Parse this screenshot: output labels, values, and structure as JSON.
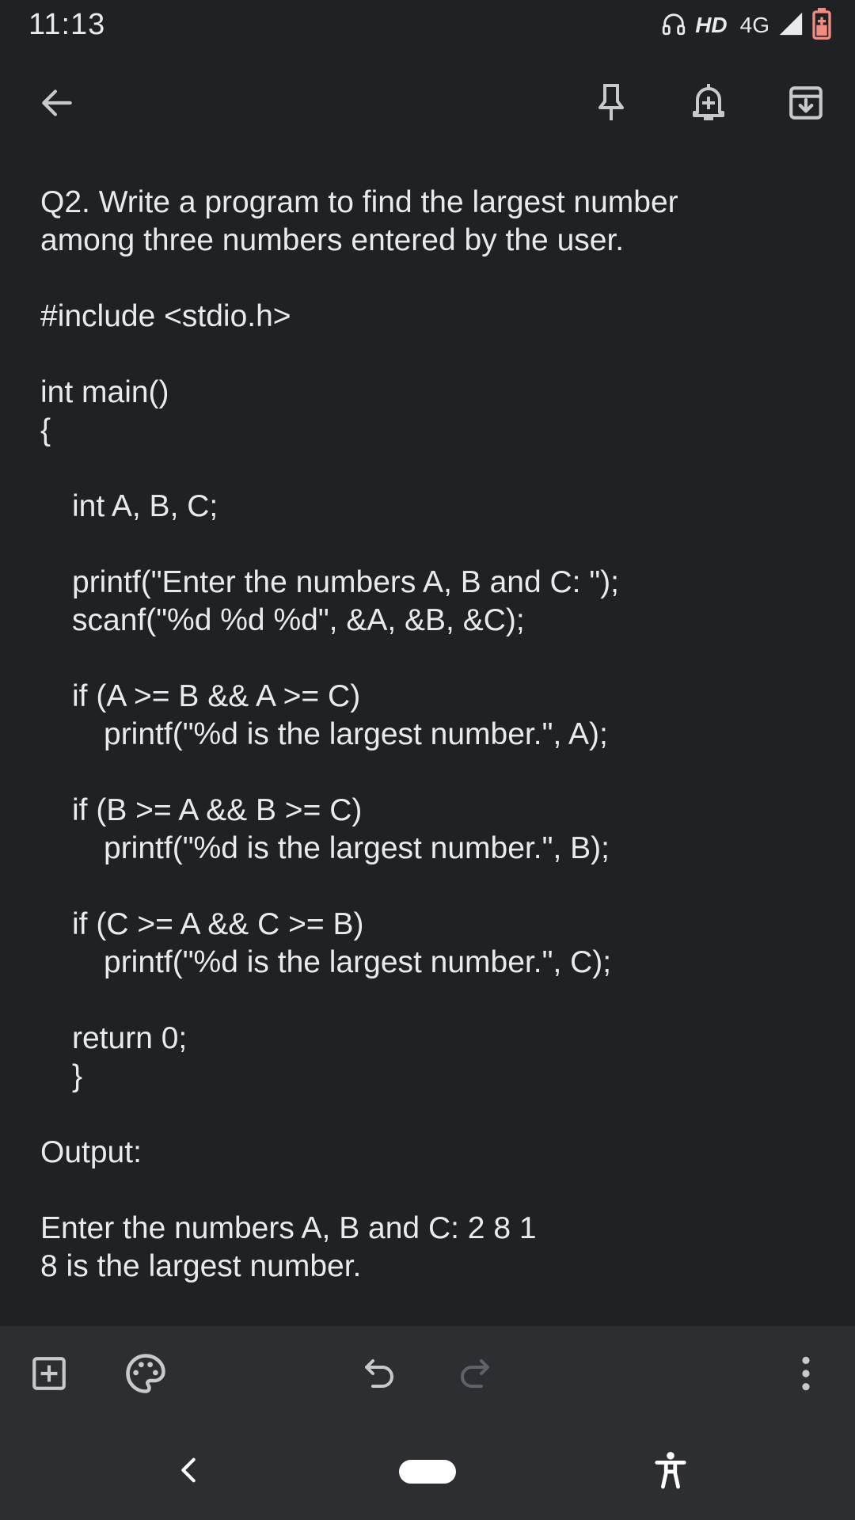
{
  "status_bar": {
    "time": "11:13",
    "hd": "HD",
    "network": "4G"
  },
  "toolbar": {
    "back_icon": "arrow-left-icon",
    "pin_icon": "pin-icon",
    "reminder_icon": "bell-plus-icon",
    "archive_icon": "archive-icon"
  },
  "note": {
    "title_lines": [
      "Q2. Write a program to find the largest number",
      "among three numbers entered by the user."
    ],
    "body_lines": [
      {
        "text": "",
        "indent": 0
      },
      {
        "text": "#include <stdio.h>",
        "indent": 0
      },
      {
        "text": "",
        "indent": 0
      },
      {
        "text": "int main()",
        "indent": 0
      },
      {
        "text": "{",
        "indent": 0
      },
      {
        "text": "",
        "indent": 0
      },
      {
        "text": "int A, B, C;",
        "indent": 1
      },
      {
        "text": "",
        "indent": 0
      },
      {
        "text": "printf(\"Enter the numbers A, B and C: \");",
        "indent": 1
      },
      {
        "text": "scanf(\"%d %d %d\", &A, &B, &C);",
        "indent": 1
      },
      {
        "text": "",
        "indent": 0
      },
      {
        "text": "if (A >= B && A >= C)",
        "indent": 1
      },
      {
        "text": "printf(\"%d is the largest number.\", A);",
        "indent": 2
      },
      {
        "text": "",
        "indent": 0
      },
      {
        "text": "if (B >= A && B >= C)",
        "indent": 1
      },
      {
        "text": "printf(\"%d is the largest number.\", B);",
        "indent": 2
      },
      {
        "text": "",
        "indent": 0
      },
      {
        "text": "if (C >= A && C >= B)",
        "indent": 1
      },
      {
        "text": "printf(\"%d is the largest number.\", C);",
        "indent": 2
      },
      {
        "text": "",
        "indent": 0
      },
      {
        "text": "return 0;",
        "indent": 1
      },
      {
        "text": "}",
        "indent": 1
      },
      {
        "text": "",
        "indent": 0
      },
      {
        "text": "Output:",
        "indent": 0
      },
      {
        "text": "",
        "indent": 0
      },
      {
        "text": "Enter the numbers A, B and C: 2 8 1",
        "indent": 0
      },
      {
        "text": "8 is the largest number.",
        "indent": 0
      }
    ]
  },
  "editor_bar": {
    "add_icon": "add-box-icon",
    "palette_icon": "palette-icon",
    "undo_icon": "undo-icon",
    "redo_icon": "redo-icon",
    "more_icon": "more-vert-icon"
  },
  "nav_bar": {
    "back_icon": "nav-back-icon",
    "home_icon": "home-pill-icon",
    "accessibility_icon": "accessibility-icon"
  },
  "colors": {
    "background": "#202124",
    "bar": "#2d2e31",
    "text": "#e8eaed",
    "icon": "#c8c9cc",
    "battery_accent": "#f28b82"
  }
}
